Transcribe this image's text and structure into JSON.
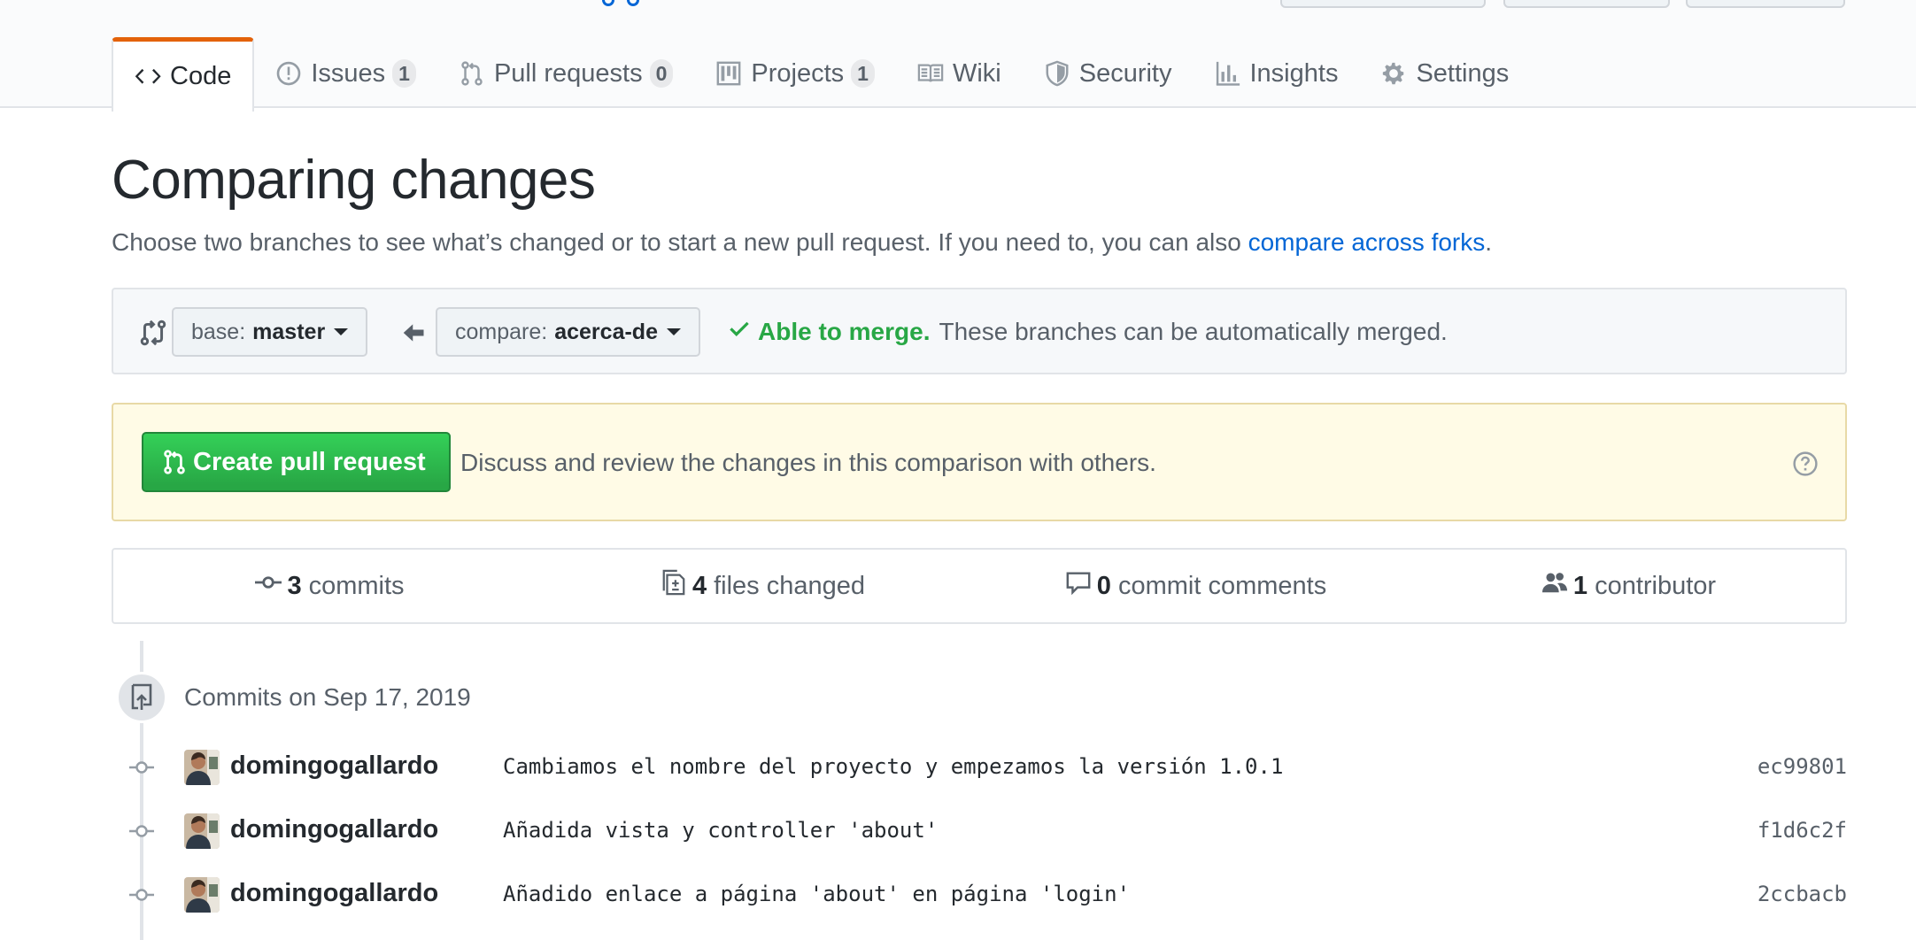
{
  "tabs": [
    {
      "label": "Code",
      "icon": "code-icon"
    },
    {
      "label": "Issues",
      "count": "1",
      "icon": "issue-opened-icon"
    },
    {
      "label": "Pull requests",
      "count": "0",
      "icon": "git-pull-request-icon"
    },
    {
      "label": "Projects",
      "count": "1",
      "icon": "project-icon"
    },
    {
      "label": "Wiki",
      "icon": "book-icon"
    },
    {
      "label": "Security",
      "icon": "shield-icon"
    },
    {
      "label": "Insights",
      "icon": "graph-icon"
    },
    {
      "label": "Settings",
      "icon": "gear-icon"
    }
  ],
  "page": {
    "title": "Comparing changes",
    "subtitle_prefix": "Choose two branches to see what’s changed or to start a new pull request. If you need to, you can also ",
    "subtitle_link": "compare across forks",
    "subtitle_suffix": "."
  },
  "range": {
    "base_label": "base:",
    "base_branch": "master",
    "compare_label": "compare:",
    "compare_branch": "acerca-de",
    "merge_ok": "Able to merge.",
    "merge_text": "These branches can be automatically merged."
  },
  "flash": {
    "button_label": "Create pull request",
    "description": "Discuss and review the changes in this comparison with others."
  },
  "summary": {
    "commits_count": "3",
    "commits_label": "commits",
    "files_count": "4",
    "files_label": "files changed",
    "comments_count": "0",
    "comments_label": "commit comments",
    "contributors_count": "1",
    "contributors_label": "contributor"
  },
  "commits_day": "Commits on Sep 17, 2019",
  "commits": [
    {
      "author": "domingogallardo",
      "message": "Cambiamos el nombre del proyecto y empezamos la versión 1.0.1",
      "sha": "ec99801"
    },
    {
      "author": "domingogallardo",
      "message": "Añadida vista y controller 'about'",
      "sha": "f1d6c2f"
    },
    {
      "author": "domingogallardo",
      "message": "Añadido enlace a página 'about' en página 'login'",
      "sha": "2ccbacb"
    }
  ],
  "colors": {
    "accent_tab": "#e36209",
    "link": "#0366d6",
    "success": "#28a745",
    "flash_bg": "#fffbe6"
  }
}
